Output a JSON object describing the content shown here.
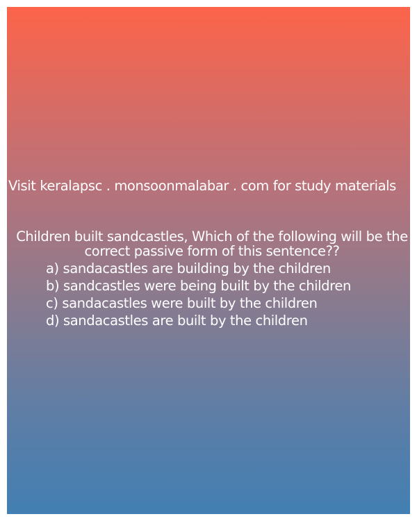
{
  "promo_text": "Visit keralapsc . monsoonmalabar . com for study materials",
  "question": "Children built sandcastles, Which of the following will be the correct passive form of this sentence??",
  "options": [
    "a) sandacastles are building by the children",
    "b) sandcastles were being built by the children",
    "c) sandacastles were built by the children",
    "d) sandacastles are built by the children"
  ],
  "colors": {
    "gradient_top": "#fd644a",
    "gradient_bottom": "#427fb2",
    "text": "#ffffff"
  }
}
